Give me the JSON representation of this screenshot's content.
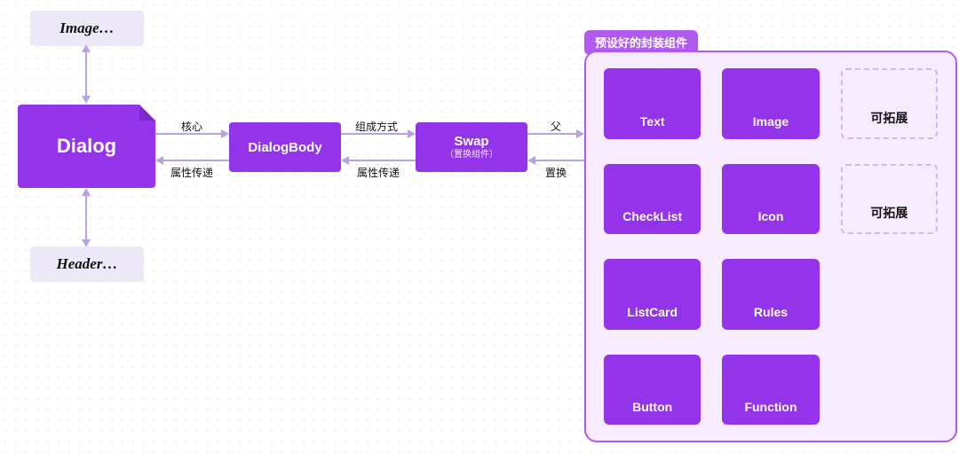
{
  "ghosts": {
    "image": "Image…",
    "header": "Header…"
  },
  "nodes": {
    "dialog": "Dialog",
    "dialogbody": "DialogBody",
    "swap_title": "Swap",
    "swap_sub": "（置换组件）"
  },
  "panel": {
    "title": "预设好的封装组件",
    "folders": [
      "Text",
      "Image",
      "可拓展",
      "CheckList",
      "Icon",
      "可拓展",
      "ListCard",
      "Rules",
      "",
      "Button",
      "Function",
      ""
    ],
    "empty_indices": [
      2,
      5,
      8,
      11
    ]
  },
  "edges": {
    "dialog_body_top": "核心",
    "dialog_body_bottom": "属性传递",
    "body_swap_top": "组成方式",
    "body_swap_bottom": "属性传递",
    "swap_panel_top": "父",
    "swap_panel_bottom": "置换"
  },
  "colors": {
    "node": "#9333ea",
    "panel_border": "#b05af0",
    "panel_bg": "#f7ecff",
    "ghost_bg": "#ece8f7",
    "edge": "#b9a1e5"
  }
}
